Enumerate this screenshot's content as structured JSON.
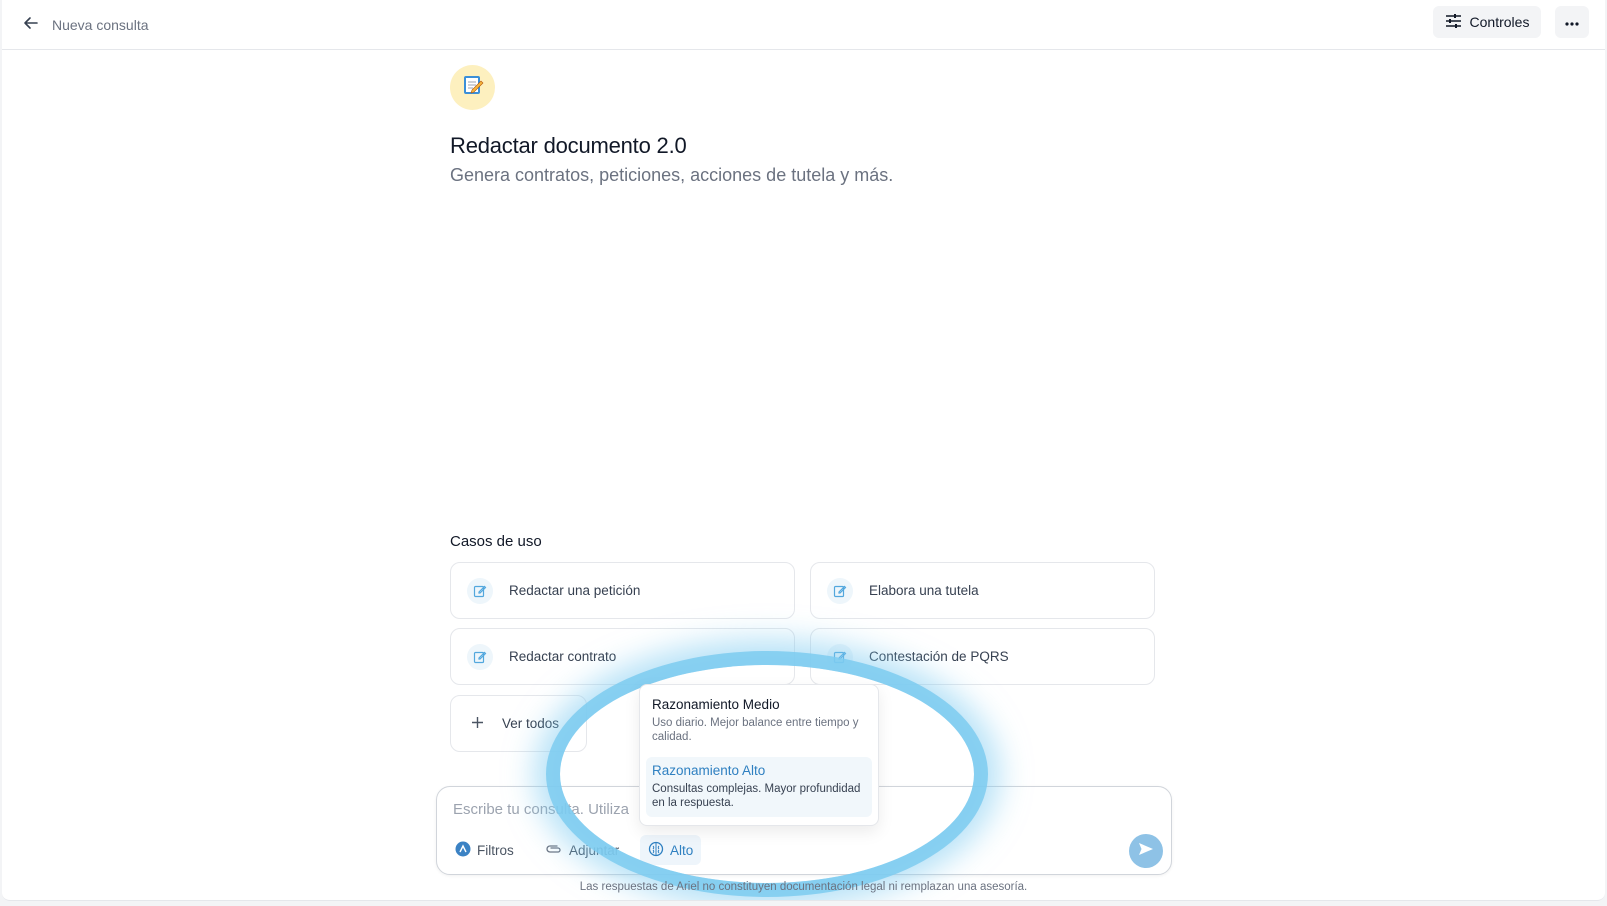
{
  "header": {
    "back_label": "Nueva consulta",
    "controls_label": "Controles"
  },
  "assistant": {
    "emoji": "📝",
    "title": "Redactar documento 2.0",
    "subtitle": "Genera contratos, peticiones, acciones de tutela y más."
  },
  "use_cases": {
    "heading": "Casos de uso",
    "items": [
      {
        "label": "Redactar una petición"
      },
      {
        "label": "Elabora una tutela"
      },
      {
        "label": "Redactar contrato"
      },
      {
        "label": "Contestación de PQRS"
      }
    ],
    "see_all_label": "Ver todos"
  },
  "composer": {
    "placeholder": "Escribe tu consulta. Utiliza",
    "filters_label": "Filtros",
    "attach_label": "Adjuntar",
    "reasoning_label": "Alto"
  },
  "reasoning_menu": {
    "options": [
      {
        "name": "Razonamiento Medio",
        "desc": "Uso diario. Mejor balance entre tiempo y calidad.",
        "selected": false
      },
      {
        "name": "Razonamiento Alto",
        "desc": "Consultas complejas. Mayor profundidad en la respuesta.",
        "selected": true
      }
    ]
  },
  "footer": {
    "disclaimer": "Las respuestas de Ariel no constituyen documentación legal ni remplazan una asesoría."
  },
  "colors": {
    "accent": "#2f80c1",
    "halo": "#7ccbf0",
    "send_button": "#8ec2e6"
  }
}
